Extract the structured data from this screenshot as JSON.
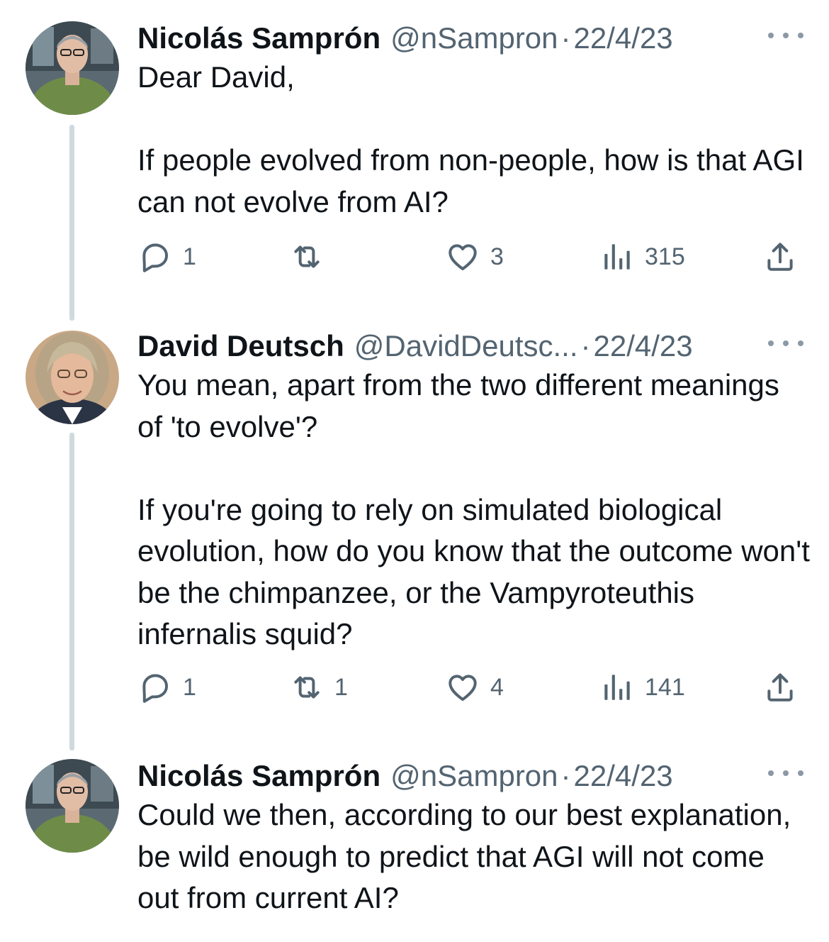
{
  "tweets": [
    {
      "author_name": "Nicolás Samprón",
      "handle": "@nSampron",
      "date": "22/4/23",
      "paragraphs": [
        "Dear David,",
        "If people evolved from non-people, how is that AGI can not evolve from AI?"
      ],
      "replies": "1",
      "retweets": "",
      "likes": "3",
      "views": "315"
    },
    {
      "author_name": "David Deutsch",
      "handle": "@DavidDeutsc...",
      "date": "22/4/23",
      "paragraphs": [
        "You mean, apart from the two different meanings of 'to evolve'?",
        "If you're going to rely on simulated biological evolution, how do you know that the outcome won't be the chimpanzee, or the Vampyroteuthis infernalis squid?"
      ],
      "replies": "1",
      "retweets": "1",
      "likes": "4",
      "views": "141"
    },
    {
      "author_name": "Nicolás Samprón",
      "handle": "@nSampron",
      "date": "22/4/23",
      "paragraphs": [
        "Could we then, according to our best explanation, be wild enough to predict that AGI will not come out from current AI?"
      ]
    }
  ],
  "icons": {
    "reply": "reply-icon",
    "retweet": "retweet-icon",
    "like": "heart-icon",
    "views": "views-icon",
    "share": "share-icon",
    "more": "more-icon"
  },
  "colors": {
    "text": "#0f1419",
    "secondary": "#536471",
    "thread_line": "#cfd9de"
  }
}
